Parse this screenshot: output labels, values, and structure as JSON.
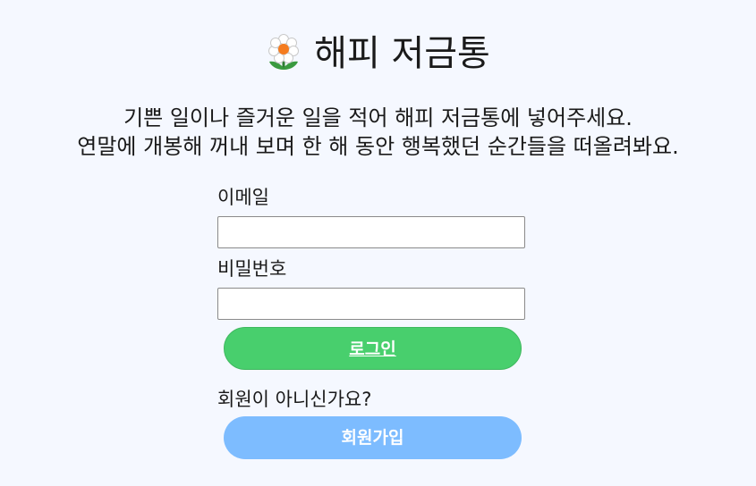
{
  "header": {
    "title": "해피 저금통",
    "icon": "flower-icon"
  },
  "description": {
    "line1": "기쁜 일이나 즐거운 일을 적어 해피 저금통에 넣어주세요.",
    "line2": "연말에 개봉해 꺼내 보며 한 해 동안 행복했던 순간들을 떠올려봐요."
  },
  "form": {
    "email_label": "이메일",
    "email_value": "",
    "password_label": "비밀번호",
    "password_value": "",
    "login_label": "로그인",
    "signup_prompt": "회원이 아니신가요?",
    "signup_label": "회원가입"
  },
  "colors": {
    "background": "#f5f8ff",
    "login": "#48cf6d",
    "signup": "#7dbcff"
  }
}
